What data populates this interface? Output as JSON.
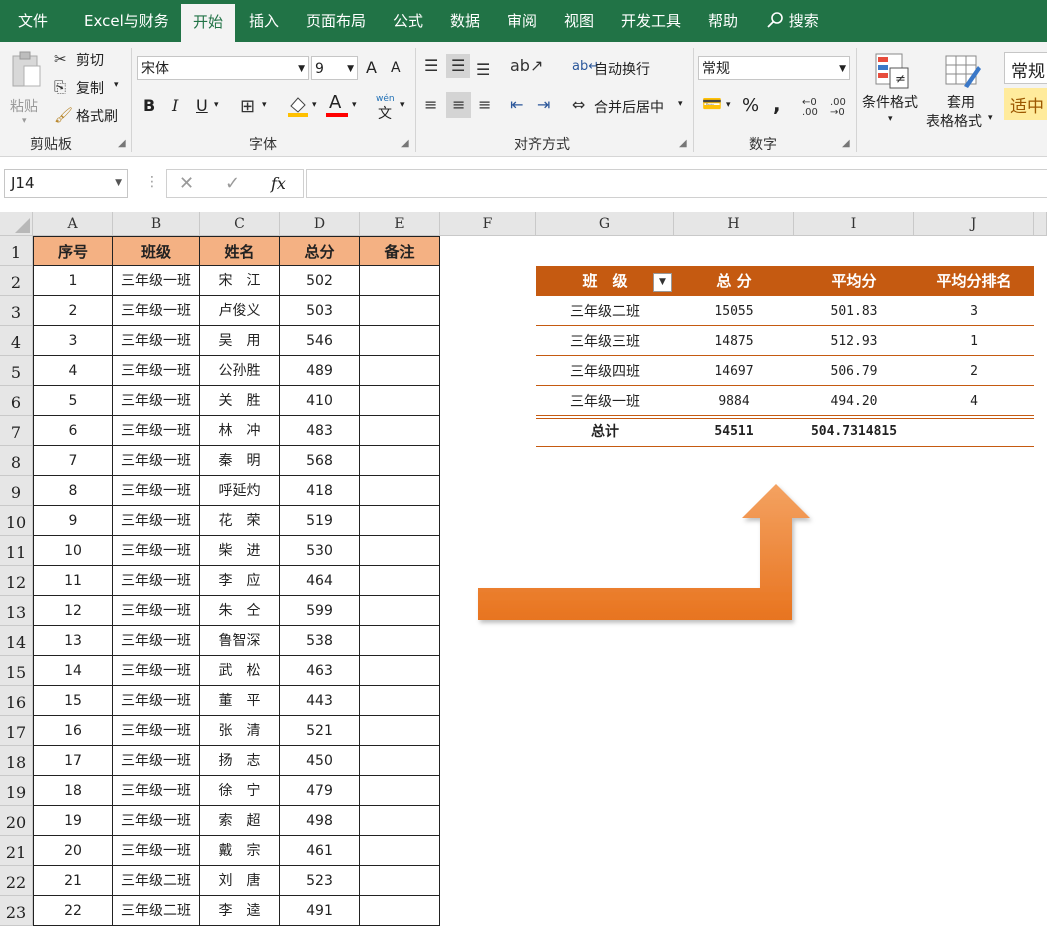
{
  "tabs": [
    "文件",
    "Excel与财务",
    "开始",
    "插入",
    "页面布局",
    "公式",
    "数据",
    "审阅",
    "视图",
    "开发工具",
    "帮助",
    "搜索"
  ],
  "ribbon": {
    "clipboard": {
      "paste": "粘贴",
      "cut": "剪切",
      "copy": "复制",
      "format_painter": "格式刷",
      "group": "剪贴板"
    },
    "font": {
      "name": "宋体",
      "size": "9",
      "grow": "A",
      "shrink": "A",
      "bold": "B",
      "italic": "I",
      "underline": "U",
      "group": "字体",
      "phonetic": "wén"
    },
    "align": {
      "wrap": "自动换行",
      "merge": "合并后居中",
      "group": "对齐方式"
    },
    "number": {
      "format": "常规",
      "percent": "%",
      "comma": ",",
      "group": "数字"
    },
    "styles": {
      "conditional": "条件格式",
      "table1": "套用",
      "table2": "表格格式",
      "style_normal": "常规",
      "style_neutral": "适中"
    }
  },
  "formula_bar": {
    "name_box": "J14",
    "cancel": "✕",
    "enter": "✓",
    "fx": "fx",
    "value": ""
  },
  "columns": [
    "A",
    "B",
    "C",
    "D",
    "E",
    "F",
    "G",
    "H",
    "I",
    "J"
  ],
  "row_numbers": [
    "1",
    "2",
    "3",
    "4",
    "5",
    "6",
    "7",
    "8",
    "9",
    "10",
    "11",
    "12",
    "13",
    "14",
    "15",
    "16",
    "17",
    "18",
    "19",
    "20",
    "21",
    "22",
    "23"
  ],
  "table": {
    "headers": [
      "序号",
      "班级",
      "姓名",
      "总分",
      "备注"
    ],
    "rows": [
      [
        "1",
        "三年级一班",
        "宋　江",
        "502",
        ""
      ],
      [
        "2",
        "三年级一班",
        "卢俊义",
        "503",
        ""
      ],
      [
        "3",
        "三年级一班",
        "吴　用",
        "546",
        ""
      ],
      [
        "4",
        "三年级一班",
        "公孙胜",
        "489",
        ""
      ],
      [
        "5",
        "三年级一班",
        "关　胜",
        "410",
        ""
      ],
      [
        "6",
        "三年级一班",
        "林　冲",
        "483",
        ""
      ],
      [
        "7",
        "三年级一班",
        "秦　明",
        "568",
        ""
      ],
      [
        "8",
        "三年级一班",
        "呼延灼",
        "418",
        ""
      ],
      [
        "9",
        "三年级一班",
        "花　荣",
        "519",
        ""
      ],
      [
        "10",
        "三年级一班",
        "柴　进",
        "530",
        ""
      ],
      [
        "11",
        "三年级一班",
        "李　应",
        "464",
        ""
      ],
      [
        "12",
        "三年级一班",
        "朱　仝",
        "599",
        ""
      ],
      [
        "13",
        "三年级一班",
        "鲁智深",
        "538",
        ""
      ],
      [
        "14",
        "三年级一班",
        "武　松",
        "463",
        ""
      ],
      [
        "15",
        "三年级一班",
        "董　平",
        "443",
        ""
      ],
      [
        "16",
        "三年级一班",
        "张　清",
        "521",
        ""
      ],
      [
        "17",
        "三年级一班",
        "扬　志",
        "450",
        ""
      ],
      [
        "18",
        "三年级一班",
        "徐　宁",
        "479",
        ""
      ],
      [
        "19",
        "三年级一班",
        "索　超",
        "498",
        ""
      ],
      [
        "20",
        "三年级一班",
        "戴　宗",
        "461",
        ""
      ],
      [
        "21",
        "三年级二班",
        "刘　唐",
        "523",
        ""
      ],
      [
        "22",
        "三年级二班",
        "李　逵",
        "491",
        ""
      ]
    ]
  },
  "pivot": {
    "headers": [
      "班　级",
      "总 分",
      "平均分",
      "平均分排名"
    ],
    "rows": [
      [
        "三年级二班",
        "15055",
        "501.83",
        "3"
      ],
      [
        "三年级三班",
        "14875",
        "512.93",
        "1"
      ],
      [
        "三年级四班",
        "14697",
        "506.79",
        "2"
      ],
      [
        "三年级一班",
        "9884",
        "494.20",
        "4"
      ]
    ],
    "total": [
      "总计",
      "54511",
      "504.7314815",
      ""
    ]
  },
  "colors": {
    "ribbon_green": "#217346",
    "header_fill": "#f4b183",
    "pivot_header": "#c55a11",
    "arrow": "#ed7d31"
  }
}
